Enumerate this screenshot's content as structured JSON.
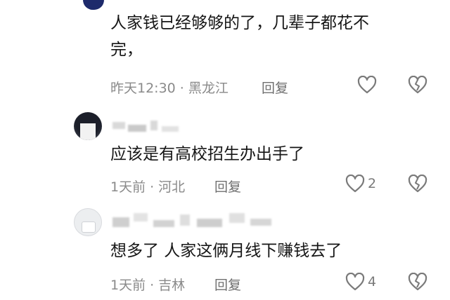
{
  "comments": [
    {
      "text_lines": [
        "人家钱已经够够的了，几辈子都花不",
        "完，"
      ],
      "time": "昨天12:30",
      "location": "黑龙江",
      "reply_label": "回复",
      "like_count": ""
    },
    {
      "text_lines": [
        "应该是有高校招生办出手了"
      ],
      "time": "1天前",
      "location": "河北",
      "reply_label": "回复",
      "like_count": "2"
    },
    {
      "text_lines": [
        "想多了 人家这俩月线下赚钱去了"
      ],
      "time": "1天前",
      "location": "吉林",
      "reply_label": "回复",
      "like_count": "4"
    }
  ],
  "separator": "·",
  "icons": {
    "like": "heart-outline-icon",
    "dislike": "broken-heart-icon"
  },
  "colors": {
    "text": "#161616",
    "meta": "#8a8a8a",
    "icon": "#7a7a7a"
  }
}
